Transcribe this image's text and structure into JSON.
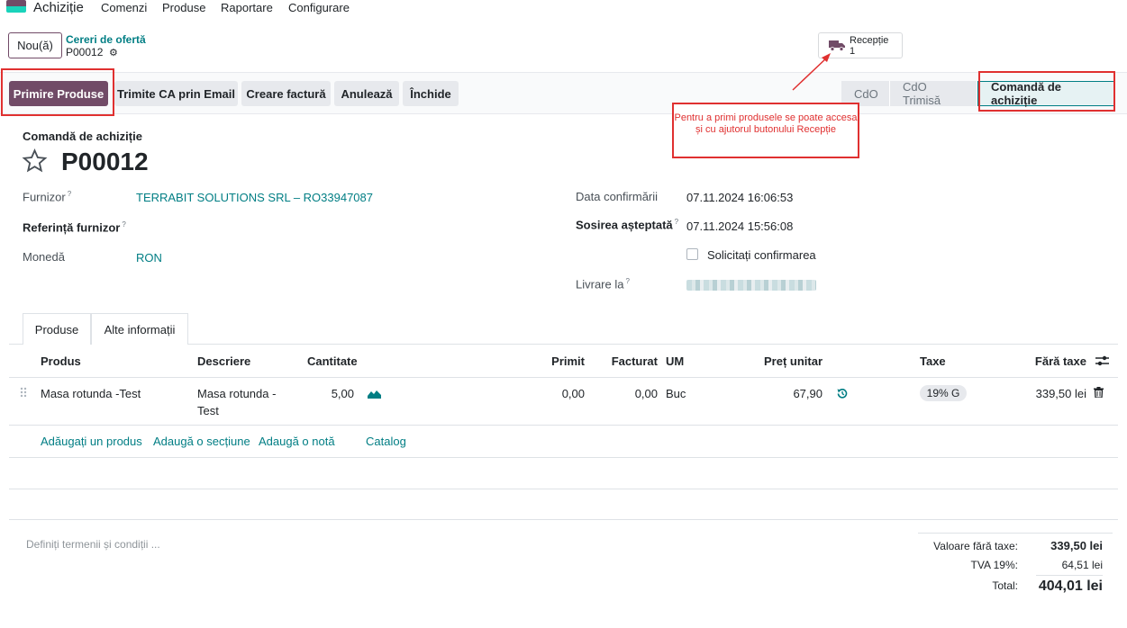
{
  "nav": {
    "app_title": "Achiziție",
    "menu": [
      "Comenzi",
      "Produse",
      "Raportare",
      "Configurare"
    ]
  },
  "control": {
    "new_button": "Nou(ă)",
    "breadcrumb_parent": "Cereri de ofertă",
    "breadcrumb_current": "P00012",
    "smart_button": {
      "label": "Recepție",
      "value": "1"
    }
  },
  "actions": [
    "Primire Produse",
    "Trimite CA prin Email",
    "Creare factură",
    "Anulează",
    "Închide"
  ],
  "status_stages": [
    "CdO",
    "CdO Trimisă",
    "Comandă de achiziție"
  ],
  "status_active": "Comandă de achiziție",
  "annotation": "Pentru a primi produsele se poate accesa și cu ajutorul butonului Recepție",
  "form": {
    "doc_type": "Comandă de achiziție",
    "name": "P00012",
    "supplier_label": "Furnizor",
    "supplier_value": "TERRABIT SOLUTIONS SRL – RO33947087",
    "ref_label": "Referință furnizor",
    "currency_label": "Monedă",
    "currency_value": "RON",
    "confirm_date_label": "Data confirmării",
    "confirm_date_value": "07.11.2024 16:06:53",
    "arrival_label": "Sosirea așteptată",
    "arrival_value": "07.11.2024 15:56:08",
    "ask_confirm_label": "Solicitați confirmarea",
    "deliver_label": "Livrare la"
  },
  "tabs": [
    "Produse",
    "Alte informații"
  ],
  "table": {
    "headers": [
      "Produs",
      "Descriere",
      "Cantitate",
      "Primit",
      "Facturat",
      "UM",
      "Preț unitar",
      "Taxe",
      "Fără taxe"
    ],
    "rows": [
      {
        "product": "Masa rotunda -Test",
        "desc_line1": "Masa rotunda -",
        "desc_line2": "Test",
        "qty": "5,00",
        "received": "0,00",
        "invoiced": "0,00",
        "uom": "Buc",
        "price": "67,90",
        "tax": "19% G",
        "subtotal": "339,50 lei"
      }
    ],
    "add_links": [
      "Adăugați un produs",
      "Adaugă o secțiune",
      "Adaugă o notă",
      "Catalog"
    ]
  },
  "terms_placeholder": "Definiți termenii și condiții ...",
  "totals": {
    "untaxed_label": "Valoare fără taxe:",
    "untaxed_value": "339,50 lei",
    "tax_label": "TVA 19%:",
    "tax_value": "64,51 lei",
    "total_label": "Total:",
    "total_value": "404,01 lei"
  },
  "colors": {
    "primary": "#714B67",
    "link": "#017e84",
    "annotation": "#e03030"
  }
}
